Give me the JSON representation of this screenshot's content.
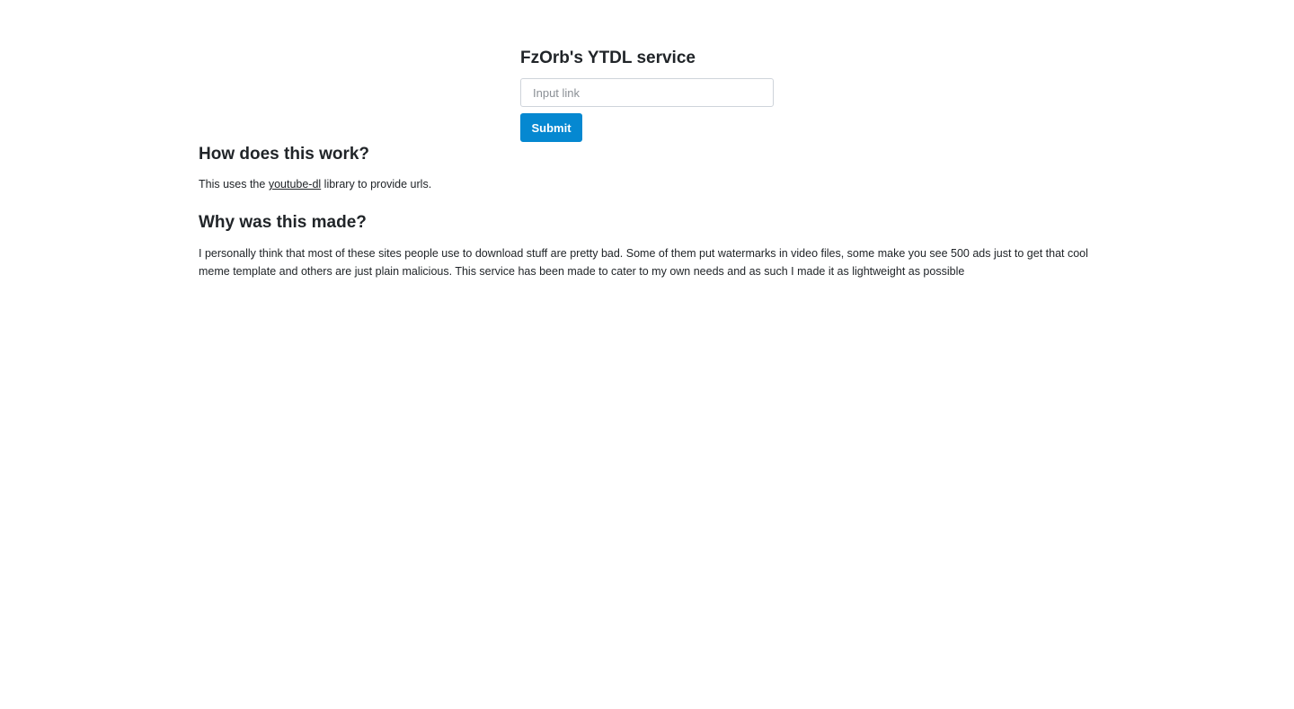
{
  "header": {
    "title": "FzOrb's YTDL service"
  },
  "form": {
    "input_placeholder": "Input link",
    "input_value": "",
    "submit_label": "Submit"
  },
  "how": {
    "heading": "How does this work?",
    "text_before": "This uses the ",
    "link_text": "youtube-dl",
    "text_after": " library to provide urls."
  },
  "why": {
    "heading": "Why was this made?",
    "text": "I personally think that most of these sites people use to download stuff are pretty bad. Some of them put watermarks in video files, some make you see 500 ads just to get that cool meme template and others are just plain malicious. This service has been made to cater to my own needs and as such I made it as lightweight as possible"
  }
}
